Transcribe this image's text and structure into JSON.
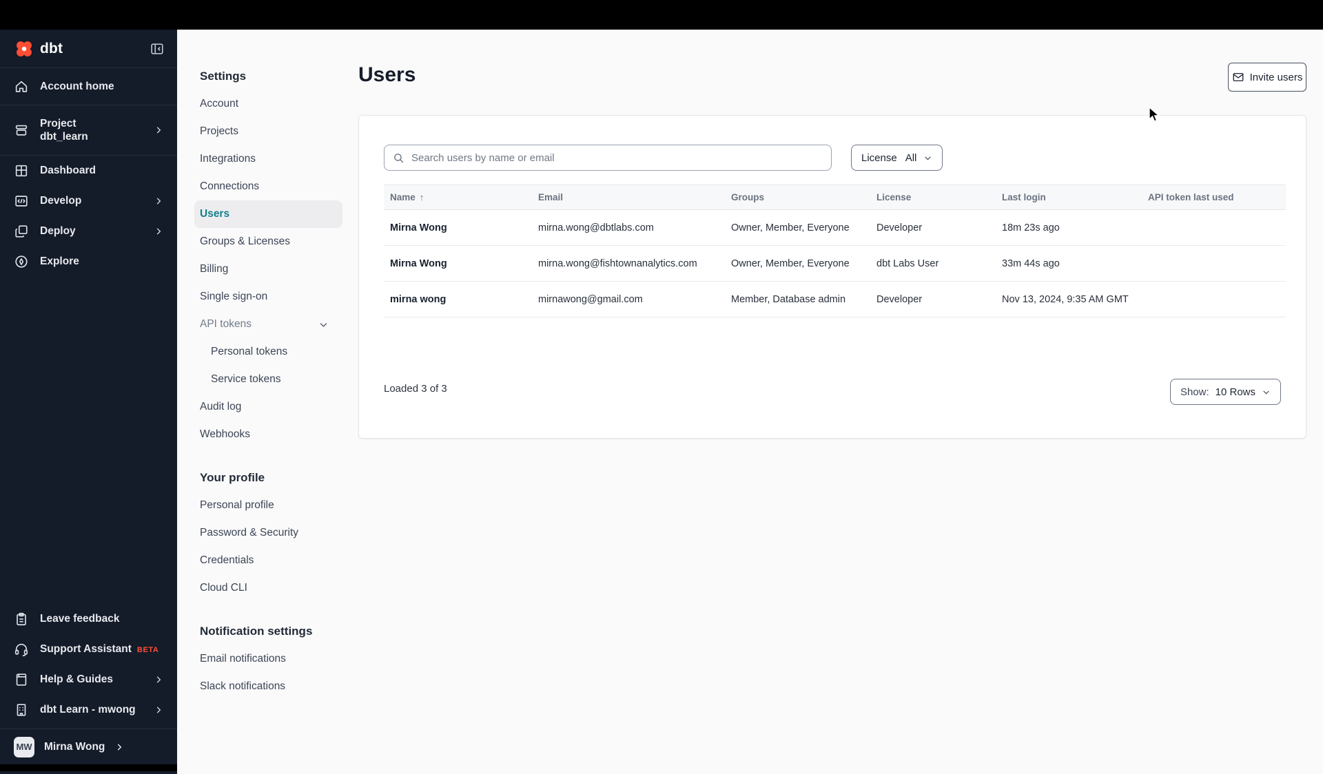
{
  "colors": {
    "accent_orange": "#ff4e33",
    "active_teal": "#12808a",
    "sidebar_bg": "#141b29"
  },
  "sidebar": {
    "logo_text": "dbt",
    "nav": [
      {
        "label": "Account home"
      },
      {
        "label": "Project",
        "sublabel": "dbt_learn"
      },
      {
        "label": "Dashboard"
      },
      {
        "label": "Develop"
      },
      {
        "label": "Deploy"
      },
      {
        "label": "Explore"
      }
    ],
    "footer": [
      {
        "label": "Leave feedback"
      },
      {
        "label": "Support Assistant",
        "badge": "BETA"
      },
      {
        "label": "Help & Guides"
      },
      {
        "label": "dbt Learn - mwong"
      }
    ],
    "user": {
      "initials": "MW",
      "name": "Mirna Wong"
    }
  },
  "settings_nav": {
    "title": "Settings",
    "items": [
      "Account",
      "Projects",
      "Integrations",
      "Connections",
      "Users",
      "Groups & Licenses",
      "Billing",
      "Single sign-on",
      "API tokens",
      "Personal tokens",
      "Service tokens",
      "Audit log",
      "Webhooks"
    ],
    "active_item": "Users",
    "profile_section": {
      "title": "Your profile",
      "items": [
        "Personal profile",
        "Password & Security",
        "Credentials",
        "Cloud CLI"
      ]
    },
    "notifications_section": {
      "title": "Notification settings",
      "items": [
        "Email notifications",
        "Slack notifications"
      ]
    }
  },
  "main": {
    "title": "Users",
    "invite_button_label": "Invite users",
    "search_placeholder": "Search users by name or email",
    "license_filter": {
      "label": "License",
      "value": "All"
    },
    "table": {
      "headers": [
        "Name",
        "Email",
        "Groups",
        "License",
        "Last login",
        "API token last used"
      ],
      "sort_indicator": "↑",
      "rows": [
        {
          "name": "Mirna Wong",
          "email": "mirna.wong@dbtlabs.com",
          "groups": "Owner, Member, Everyone",
          "license": "Developer",
          "last_login": "18m 23s ago",
          "api_token_last_used": ""
        },
        {
          "name": "Mirna Wong",
          "email": "mirna.wong@fishtownanalytics.com",
          "groups": "Owner, Member, Everyone",
          "license": "dbt Labs User",
          "last_login": "33m 44s ago",
          "api_token_last_used": ""
        },
        {
          "name": "mirna wong",
          "email": "mirnawong@gmail.com",
          "groups": "Member, Database admin",
          "license": "Developer",
          "last_login": "Nov 13, 2024, 9:35 AM GMT",
          "api_token_last_used": ""
        }
      ]
    },
    "footer": {
      "loaded_text": "Loaded 3 of 3",
      "show_label": "Show:",
      "show_value": "10 Rows"
    }
  }
}
